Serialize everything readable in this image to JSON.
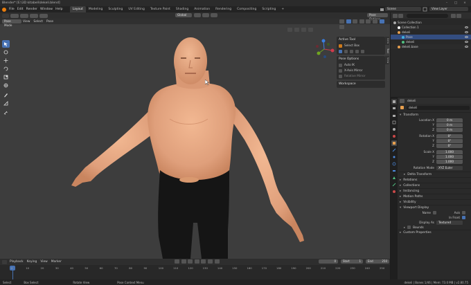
{
  "window": {
    "title": "Blender* [E:\\3D kitabeli\\dekeli.blend]",
    "controls": [
      "–",
      "□",
      "×"
    ]
  },
  "menubar": {
    "items": [
      "File",
      "Edit",
      "Render",
      "Window",
      "Help"
    ],
    "tabs": [
      "Layout",
      "Modeling",
      "Sculpting",
      "UV Editing",
      "Texture Paint",
      "Shading",
      "Animation",
      "Rendering",
      "Compositing",
      "Scripting"
    ],
    "active_tab": "Layout",
    "add_tab": "+",
    "scene": "Scene",
    "view_layer": "View Layer"
  },
  "viewport": {
    "mode": "Pose Mode",
    "menus": [
      "View",
      "Select",
      "Pose"
    ],
    "transform": "Global",
    "pose_options_btn": "Pose Options",
    "colors": {
      "background": "#3d3d3d",
      "skin": "#e8a883",
      "pants": "#151515"
    }
  },
  "npanel": {
    "active_tool_title": "Active Tool",
    "tool_name": "Select Box",
    "pose_options_title": "Pose Options",
    "options": [
      "Auto IK",
      "X-Axis Mirror",
      "Relative Mirror"
    ],
    "workspace_title": "Workspace",
    "tabs": [
      "Item",
      "Tool",
      "View"
    ]
  },
  "outliner": {
    "rows": [
      {
        "label": "Scene Collection",
        "indent": 0,
        "color": "#aaaaaa",
        "sel": false
      },
      {
        "label": "Collection 1",
        "indent": 1,
        "color": "#ffffff",
        "sel": false
      },
      {
        "label": "dekeli",
        "indent": 1,
        "color": "#e8a04f",
        "sel": false
      },
      {
        "label": "Pose",
        "indent": 2,
        "color": "#3fb0e0",
        "sel": true
      },
      {
        "label": "dekeli",
        "indent": 2,
        "color": "#50c080",
        "sel": false
      },
      {
        "label": "dekeli.base",
        "indent": 1,
        "color": "#e8a04f",
        "sel": false
      }
    ]
  },
  "properties": {
    "object_name": "dekeli",
    "object_field": "dekeli",
    "transform_title": "Transform",
    "transform": [
      {
        "label": "Location X",
        "value": "0 m",
        "pos": "top"
      },
      {
        "label": "Y",
        "value": "0 m",
        "pos": "mid"
      },
      {
        "label": "Z",
        "value": "0 m",
        "pos": "bot"
      },
      {
        "label": "Rotation X",
        "value": "0°",
        "pos": "top"
      },
      {
        "label": "Y",
        "value": "0°",
        "pos": "mid"
      },
      {
        "label": "Z",
        "value": "0°",
        "pos": "bot"
      },
      {
        "label": "Scale X",
        "value": "1.000",
        "pos": "top"
      },
      {
        "label": "Y",
        "value": "1.000",
        "pos": "mid"
      },
      {
        "label": "Z",
        "value": "1.000",
        "pos": "bot"
      }
    ],
    "rotation_mode_label": "Rotation Mode",
    "rotation_mode": "XYZ Euler",
    "delta_transform": "Delta Transform",
    "sections": [
      "Relations",
      "Collections",
      "Instancing",
      "Motion Paths",
      "Visibility"
    ],
    "viewport_display": "Viewport Display",
    "name_label": "Name",
    "axis_label": "Axis",
    "in_front_label": "In Front",
    "display_as_label": "Display As",
    "display_as": "Textured",
    "bounds_label": "Bounds",
    "custom_properties": "Custom Properties"
  },
  "timeline": {
    "menus": [
      "Playback",
      "Keying",
      "View",
      "Marker"
    ],
    "current_frame": "0",
    "start_label": "Start",
    "start": "1",
    "end_label": "End",
    "end": "250",
    "ticks": [
      "0",
      "10",
      "20",
      "30",
      "40",
      "50",
      "60",
      "70",
      "80",
      "90",
      "100",
      "110",
      "120",
      "130",
      "140",
      "150",
      "160",
      "170",
      "180",
      "190",
      "200",
      "210",
      "220",
      "230",
      "240",
      "250"
    ]
  },
  "statusbar": {
    "left": [
      "Select",
      "Box Select",
      "Rotate View",
      "Pose Context Menu"
    ],
    "right": "dekeli | Bones 1/46 | Mem: 73.0 MB | v2.80.75"
  }
}
